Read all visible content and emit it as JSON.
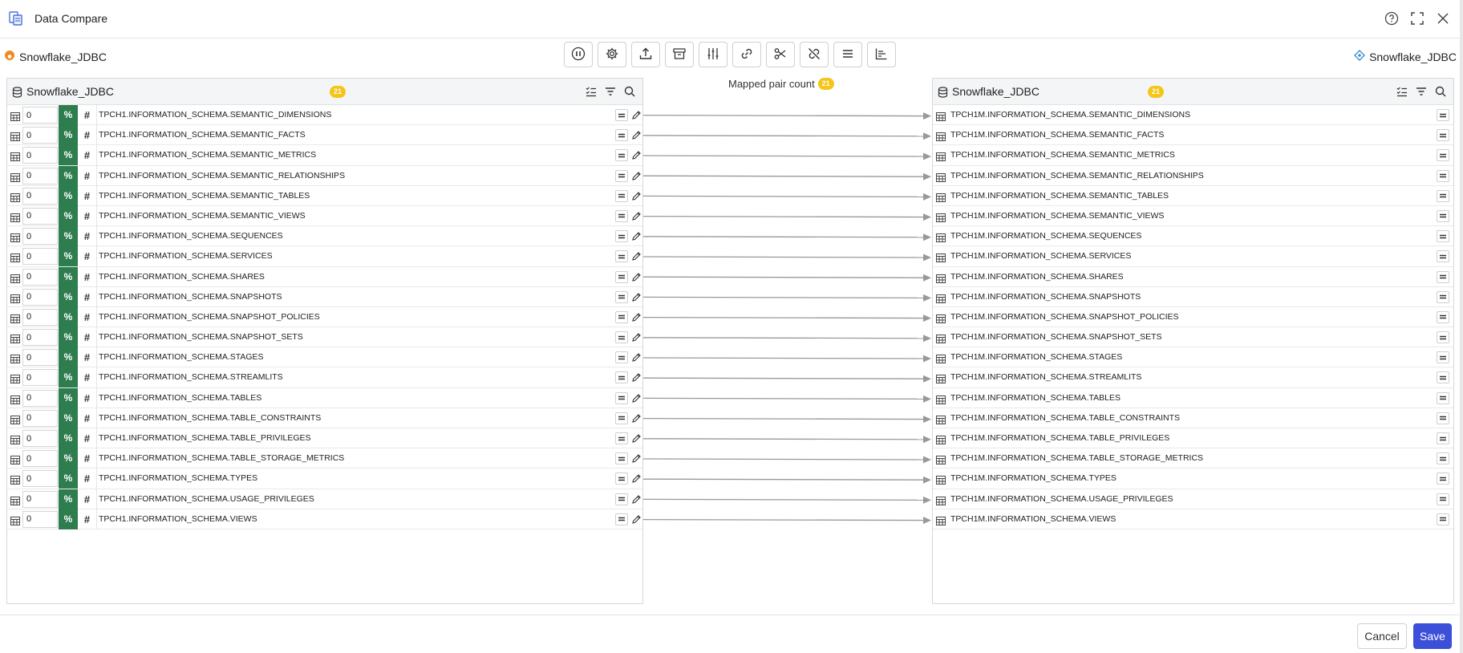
{
  "app": {
    "title": "Data Compare",
    "icon": "data-compare-icon"
  },
  "title_actions": [
    "help-icon",
    "fullscreen-icon",
    "close-icon"
  ],
  "topbar": {
    "left_connection": "Snowflake_JDBC",
    "right_connection": "Snowflake_JDBC",
    "toolbar": [
      "pause-icon",
      "settings-gear-icon",
      "upload-icon",
      "archive-icon",
      "sliders-icon",
      "link-icon",
      "scissors-icon",
      "unlink-icon",
      "list-lines-icon",
      "bar-chart-icon"
    ]
  },
  "left_panel": {
    "title": "Snowflake_JDBC",
    "count": "21",
    "rows": [
      {
        "count": "0",
        "name": "TPCH1.INFORMATION_SCHEMA.SEMANTIC_DIMENSIONS"
      },
      {
        "count": "0",
        "name": "TPCH1.INFORMATION_SCHEMA.SEMANTIC_FACTS"
      },
      {
        "count": "0",
        "name": "TPCH1.INFORMATION_SCHEMA.SEMANTIC_METRICS"
      },
      {
        "count": "0",
        "name": "TPCH1.INFORMATION_SCHEMA.SEMANTIC_RELATIONSHIPS"
      },
      {
        "count": "0",
        "name": "TPCH1.INFORMATION_SCHEMA.SEMANTIC_TABLES"
      },
      {
        "count": "0",
        "name": "TPCH1.INFORMATION_SCHEMA.SEMANTIC_VIEWS"
      },
      {
        "count": "0",
        "name": "TPCH1.INFORMATION_SCHEMA.SEQUENCES"
      },
      {
        "count": "0",
        "name": "TPCH1.INFORMATION_SCHEMA.SERVICES"
      },
      {
        "count": "0",
        "name": "TPCH1.INFORMATION_SCHEMA.SHARES"
      },
      {
        "count": "0",
        "name": "TPCH1.INFORMATION_SCHEMA.SNAPSHOTS"
      },
      {
        "count": "0",
        "name": "TPCH1.INFORMATION_SCHEMA.SNAPSHOT_POLICIES"
      },
      {
        "count": "0",
        "name": "TPCH1.INFORMATION_SCHEMA.SNAPSHOT_SETS"
      },
      {
        "count": "0",
        "name": "TPCH1.INFORMATION_SCHEMA.STAGES"
      },
      {
        "count": "0",
        "name": "TPCH1.INFORMATION_SCHEMA.STREAMLITS"
      },
      {
        "count": "0",
        "name": "TPCH1.INFORMATION_SCHEMA.TABLES"
      },
      {
        "count": "0",
        "name": "TPCH1.INFORMATION_SCHEMA.TABLE_CONSTRAINTS"
      },
      {
        "count": "0",
        "name": "TPCH1.INFORMATION_SCHEMA.TABLE_PRIVILEGES"
      },
      {
        "count": "0",
        "name": "TPCH1.INFORMATION_SCHEMA.TABLE_STORAGE_METRICS"
      },
      {
        "count": "0",
        "name": "TPCH1.INFORMATION_SCHEMA.TYPES"
      },
      {
        "count": "0",
        "name": "TPCH1.INFORMATION_SCHEMA.USAGE_PRIVILEGES"
      },
      {
        "count": "0",
        "name": "TPCH1.INFORMATION_SCHEMA.VIEWS"
      }
    ]
  },
  "right_panel": {
    "title": "Snowflake_JDBC",
    "count": "21",
    "rows": [
      {
        "name": "TPCH1M.INFORMATION_SCHEMA.SEMANTIC_DIMENSIONS"
      },
      {
        "name": "TPCH1M.INFORMATION_SCHEMA.SEMANTIC_FACTS"
      },
      {
        "name": "TPCH1M.INFORMATION_SCHEMA.SEMANTIC_METRICS"
      },
      {
        "name": "TPCH1M.INFORMATION_SCHEMA.SEMANTIC_RELATIONSHIPS"
      },
      {
        "name": "TPCH1M.INFORMATION_SCHEMA.SEMANTIC_TABLES"
      },
      {
        "name": "TPCH1M.INFORMATION_SCHEMA.SEMANTIC_VIEWS"
      },
      {
        "name": "TPCH1M.INFORMATION_SCHEMA.SEQUENCES"
      },
      {
        "name": "TPCH1M.INFORMATION_SCHEMA.SERVICES"
      },
      {
        "name": "TPCH1M.INFORMATION_SCHEMA.SHARES"
      },
      {
        "name": "TPCH1M.INFORMATION_SCHEMA.SNAPSHOTS"
      },
      {
        "name": "TPCH1M.INFORMATION_SCHEMA.SNAPSHOT_POLICIES"
      },
      {
        "name": "TPCH1M.INFORMATION_SCHEMA.SNAPSHOT_SETS"
      },
      {
        "name": "TPCH1M.INFORMATION_SCHEMA.STAGES"
      },
      {
        "name": "TPCH1M.INFORMATION_SCHEMA.STREAMLITS"
      },
      {
        "name": "TPCH1M.INFORMATION_SCHEMA.TABLES"
      },
      {
        "name": "TPCH1M.INFORMATION_SCHEMA.TABLE_CONSTRAINTS"
      },
      {
        "name": "TPCH1M.INFORMATION_SCHEMA.TABLE_PRIVILEGES"
      },
      {
        "name": "TPCH1M.INFORMATION_SCHEMA.TABLE_STORAGE_METRICS"
      },
      {
        "name": "TPCH1M.INFORMATION_SCHEMA.TYPES"
      },
      {
        "name": "TPCH1M.INFORMATION_SCHEMA.USAGE_PRIVILEGES"
      },
      {
        "name": "TPCH1M.INFORMATION_SCHEMA.VIEWS"
      }
    ]
  },
  "mapping": {
    "label": "Mapped pair count",
    "count": "21"
  },
  "footer": {
    "cancel_label": "Cancel",
    "save_label": "Save"
  },
  "colors": {
    "accent": "#3b4fd8",
    "badge": "#f5c518",
    "percent": "#2e7d4f",
    "connection_icon": "#f08a24",
    "connector_line": "#999999"
  }
}
